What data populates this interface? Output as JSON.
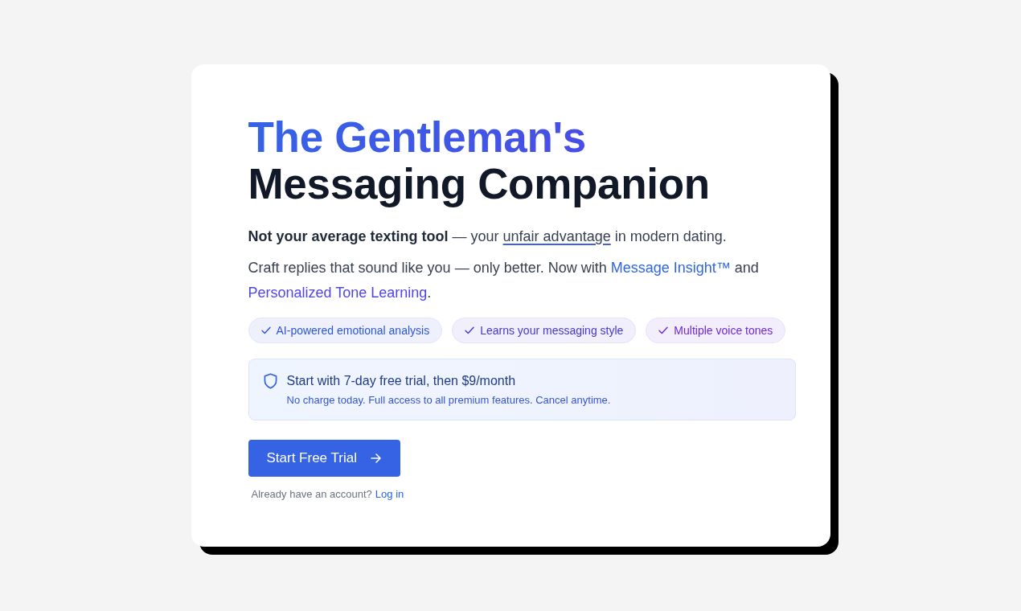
{
  "hero": {
    "title": {
      "accent": "The Gentleman's",
      "main": "Messaging Companion"
    },
    "tagline": [
      {
        "text": "Not your average texting tool",
        "kind": "bold"
      },
      {
        "text": " — your ",
        "kind": "plain"
      },
      {
        "text": "unfair advantage",
        "kind": "underline"
      },
      {
        "text": " in modern dating.",
        "kind": "plain"
      }
    ],
    "description": [
      {
        "text": "Craft replies that sound like you — only better. Now with ",
        "kind": "plain"
      },
      {
        "text": "Message Insight™",
        "kind": "accent",
        "color": "#2f66e4"
      },
      {
        "text": " and ",
        "kind": "plain"
      },
      {
        "text": "Personalized Tone Learning",
        "kind": "accent",
        "color": "#4f46e5"
      },
      {
        "text": ".",
        "kind": "plain"
      }
    ],
    "features": [
      {
        "label": "AI-powered emotional analysis",
        "color": "#2b55d6"
      },
      {
        "label": "Learns your messaging style",
        "color": "#4338ca"
      },
      {
        "label": "Multiple voice tones",
        "color": "#6d28d9"
      }
    ],
    "notice": {
      "title": "Start with 7-day free trial, then $9/month",
      "subtitle": "No charge today. Full access to all premium features. Cancel anytime."
    },
    "cta": {
      "label": "Start Free Trial"
    },
    "login": {
      "prompt": "Already have an account?",
      "link": "Log in"
    }
  }
}
